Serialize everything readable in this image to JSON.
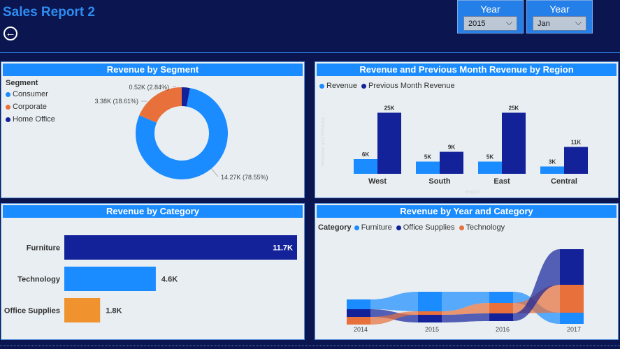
{
  "page": {
    "title": "Sales Report 2",
    "back_icon": "back-arrow-icon"
  },
  "slicers": [
    {
      "label": "Year",
      "value": "2015"
    },
    {
      "label": "Year",
      "value": "Jan"
    }
  ],
  "segment_panel": {
    "title": "Revenue by Segment",
    "legend_title": "Segment",
    "items": [
      {
        "name": "Consumer",
        "color": "#1a8cff",
        "label": "14.27K (78.55%)"
      },
      {
        "name": "Corporate",
        "color": "#e8703a",
        "label": "3.38K (18.61%)"
      },
      {
        "name": "Home Office",
        "color": "#14229a",
        "label": "0.52K (2.84%)"
      }
    ]
  },
  "region_panel": {
    "title": "Revenue and Previous Month Revenue by Region",
    "legend": [
      {
        "name": "Revenue",
        "color": "#1a8cff"
      },
      {
        "name": "Previous Month Revenue",
        "color": "#14229a"
      }
    ],
    "y_axis_label": "Revenue and Previous ...",
    "x_axis_label": "Region"
  },
  "category_panel": {
    "title": "Revenue by Category"
  },
  "year_category_panel": {
    "title": "Revenue by Year and Category",
    "legend_title": "Category",
    "legend": [
      {
        "name": "Furniture",
        "color": "#1a8cff"
      },
      {
        "name": "Office Supplies",
        "color": "#14229a"
      },
      {
        "name": "Technology",
        "color": "#e8703a"
      }
    ]
  },
  "chart_data": [
    {
      "type": "pie",
      "title": "Revenue by Segment",
      "categories": [
        "Consumer",
        "Corporate",
        "Home Office"
      ],
      "values": [
        14.27,
        3.38,
        0.52
      ],
      "labels": [
        "14.27K (78.55%)",
        "3.38K (18.61%)",
        "0.52K (2.84%)"
      ]
    },
    {
      "type": "bar",
      "title": "Revenue and Previous Month Revenue by Region",
      "categories": [
        "West",
        "South",
        "East",
        "Central"
      ],
      "series": [
        {
          "name": "Revenue",
          "values": [
            6,
            5,
            5,
            3
          ],
          "labels": [
            "6K",
            "5K",
            "5K",
            "3K"
          ]
        },
        {
          "name": "Previous Month Revenue",
          "values": [
            25,
            9,
            25,
            11
          ],
          "labels": [
            "25K",
            "9K",
            "25K",
            "11K"
          ]
        }
      ],
      "xlabel": "Region",
      "ylabel": "Revenue and Previous ...",
      "ylim": [
        0,
        28
      ]
    },
    {
      "type": "bar",
      "title": "Revenue by Category",
      "orientation": "horizontal",
      "categories": [
        "Furniture",
        "Technology",
        "Office Supplies"
      ],
      "values": [
        11.7,
        4.6,
        1.8
      ],
      "labels": [
        "11.7K",
        "4.6K",
        "1.8K"
      ],
      "colors": [
        "#14229a",
        "#1a8cff",
        "#f0922e"
      ]
    },
    {
      "type": "area",
      "title": "Revenue by Year and Category",
      "categories": [
        "2014",
        "2015",
        "2016",
        "2017"
      ],
      "series": [
        {
          "name": "Furniture",
          "values": [
            1,
            3,
            3,
            3
          ]
        },
        {
          "name": "Office Supplies",
          "values": [
            1,
            1,
            1,
            5
          ]
        },
        {
          "name": "Technology",
          "values": [
            1,
            1,
            1,
            4
          ]
        }
      ]
    }
  ]
}
